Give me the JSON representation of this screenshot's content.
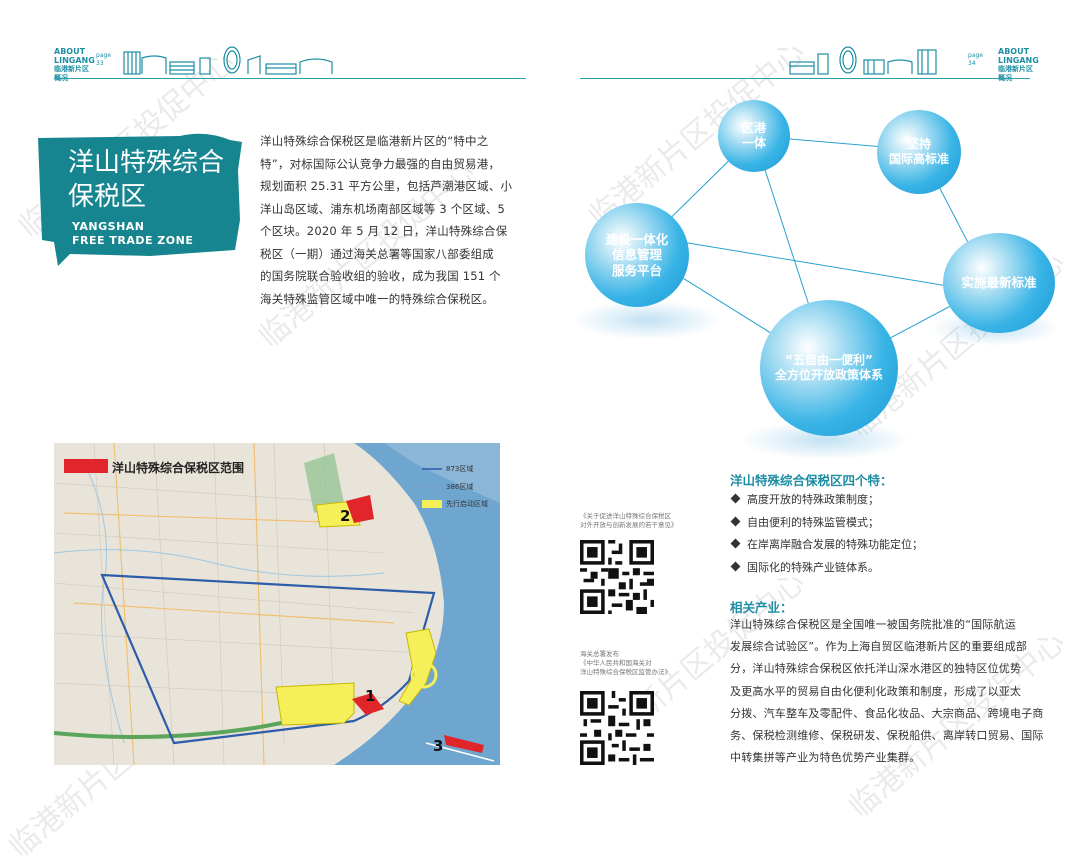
{
  "header_left": {
    "about": "ABOUT",
    "lingang": "LINGANG",
    "area": "临港新片区",
    "overview": "概况",
    "page_label": "page",
    "page_num": "33"
  },
  "header_right": {
    "about": "ABOUT",
    "lingang": "LINGANG",
    "area": "临港新片区",
    "overview": "概况",
    "page_label": "page",
    "page_num": "34"
  },
  "banner": {
    "title_line1": "洋山特殊综合",
    "title_line2": "保税区",
    "en_line1": "YANGSHAN",
    "en_line2": "FREE TRADE ZONE",
    "color": "#17858f"
  },
  "intro_lines": [
    "洋山特殊综合保税区是临港新片区的“特中之",
    "特”，对标国际公认竞争力最强的自由贸易港，",
    "规划面积 25.31 平方公里，包括芦潮港区域、小",
    "洋山岛区域、浦东机场南部区域等 3 个区域、5",
    "个区块。2020 年 5 月 12 日，洋山特殊综合保",
    "税区（一期）通过海关总署等国家八部委组成",
    "的国务院联合验收组的验收，成为我国 151 个",
    "海关特殊监管区域中唯一的特殊综合保税区。"
  ],
  "map": {
    "legend_title": "洋山特殊综合保税区范围",
    "legend_items": [
      "873区域",
      "386区域",
      "先行启动区域"
    ],
    "labels": [
      "1",
      "2",
      "3"
    ],
    "colors": {
      "red": "#e0262b",
      "yellow": "#f5ef5a",
      "blue": "#2d5ca8",
      "sea": "#6fa6d0"
    }
  },
  "bubbles": {
    "b1": {
      "line1": "区港",
      "line2": "一体"
    },
    "b2": {
      "line1": "坚持",
      "line2": "国际高标准"
    },
    "b3": {
      "line1": "建设一体化",
      "line2": "信息管理",
      "line3": "服务平台"
    },
    "b4": {
      "line1": "实施最新标准"
    },
    "b5": {
      "line1": "“五自由一便利”",
      "line2": "全方位开放政策体系"
    }
  },
  "qr1": {
    "caption_line1": "《关于促进洋山特殊综合保税区",
    "caption_line2": "对外开放与创新发展的若干意见》"
  },
  "qr2": {
    "caption_line1": "海关总署发布",
    "caption_line2": "《中华人民共和国海关对",
    "caption_line3": "洋山特殊综合保税区监管办法》"
  },
  "features": {
    "title": "洋山特殊综合保税区四个特：",
    "items": [
      "高度开放的特殊政策制度；",
      "自由便利的特殊监管模式；",
      "在岸离岸融合发展的特殊功能定位；",
      "国际化的特殊产业链体系。"
    ]
  },
  "industry": {
    "title": "相关产业：",
    "lines": [
      "洋山特殊综合保税区是全国唯一被国务院批准的“国际航运",
      "发展综合试验区”。作为上海自贸区临港新片区的重要组成部",
      "分，洋山特殊综合保税区依托洋山深水港区的独特区位优势",
      "及更高水平的贸易自由化便利化政策和制度，形成了以亚太",
      "分拨、汽车整车及零配件、食品化妆品、大宗商品、跨境电子商",
      "务、保税检测维修、保税研发、保税船供、离岸转口贸易、国际",
      "中转集拼等产业为特色优势产业集群。"
    ]
  },
  "watermark": "临港新片区投促中心",
  "accent": "#1d8ea3"
}
